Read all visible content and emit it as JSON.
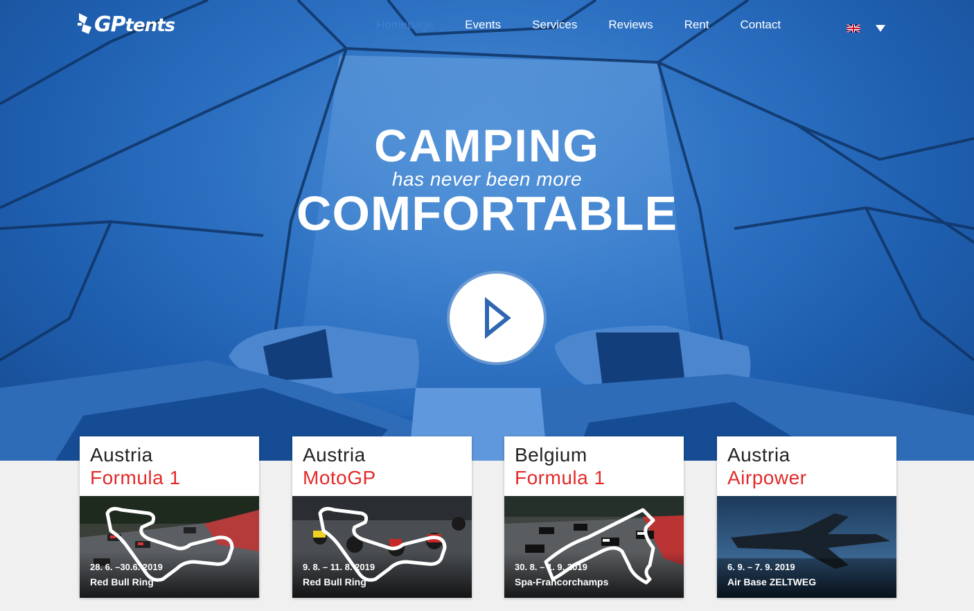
{
  "header": {
    "logo_text_big": "GP",
    "logo_text_small": "tents",
    "nav": [
      {
        "label": "Homepage",
        "active": true
      },
      {
        "label": "Events"
      },
      {
        "label": "Services"
      },
      {
        "label": "Reviews"
      },
      {
        "label": "Rent"
      },
      {
        "label": "Contact"
      }
    ],
    "language_icon": "flag-uk-icon"
  },
  "hero": {
    "title_top": "CAMPING",
    "subtitle": "has never been more",
    "title_bottom": "COMFORTABLE",
    "play_icon": "play-icon"
  },
  "events": [
    {
      "country": "Austria",
      "series": "Formula 1",
      "date": "28. 6. –30.6. 2019",
      "venue": "Red Bull Ring"
    },
    {
      "country": "Austria",
      "series": "MotoGP",
      "date": "9. 8. – 11. 8. 2019",
      "venue": "Red Bull Ring"
    },
    {
      "country": "Belgium",
      "series": "Formula 1",
      "date": "30. 8. – 1. 9. 2019",
      "venue": "Spa-Francorchamps"
    },
    {
      "country": "Austria",
      "series": "Airpower",
      "date": "6. 9. – 7. 9. 2019",
      "venue": "Air Base ZELTWEG"
    }
  ],
  "colors": {
    "accent_red": "#e22a2a",
    "nav_active": "#3d7fd0",
    "hero_blue": "#2f73c4"
  }
}
